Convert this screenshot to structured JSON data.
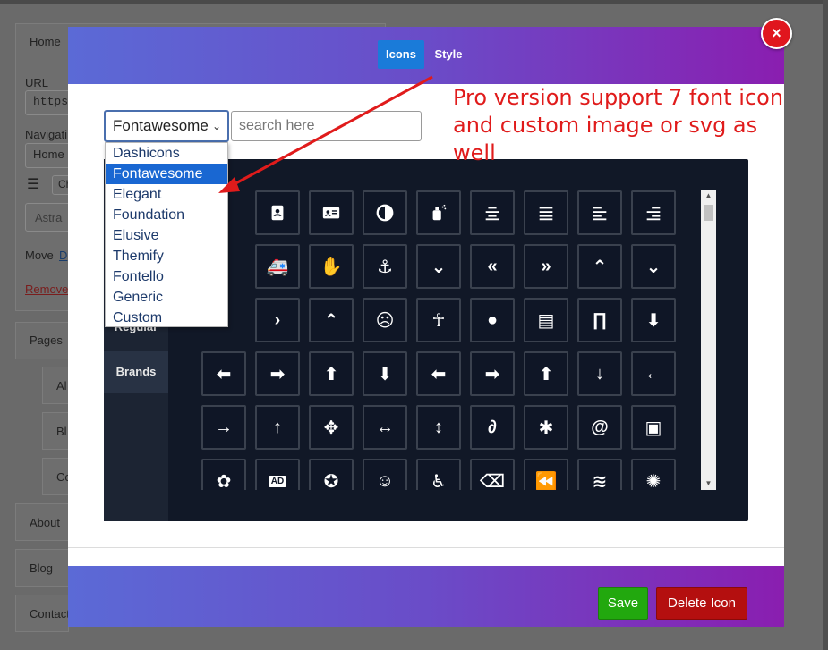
{
  "background": {
    "home_label": "Home",
    "url_label": "URL",
    "url_value": "https",
    "navigation_label": "Navigati",
    "navigation_value": "Home",
    "chip_text": "Ch",
    "astra_text": "Astra",
    "move_label": "Move",
    "move_link": "D",
    "remove_link": "Remove",
    "sections": [
      "Pages",
      "About",
      "Blog",
      "Contact"
    ],
    "subitems": [
      "Al",
      "Bl",
      "Co"
    ]
  },
  "modal": {
    "tabs": [
      {
        "label": "Icons",
        "active": true
      },
      {
        "label": "Style",
        "active": false
      }
    ],
    "close_symbol": "×",
    "select": {
      "value": "Fontawesome",
      "chevron": "⌄"
    },
    "search": {
      "placeholder": "search here"
    },
    "dropdown_options": [
      "Dashicons",
      "Fontawesome",
      "Elegant",
      "Foundation",
      "Elusive",
      "Themify",
      "Fontello",
      "Generic",
      "Custom"
    ],
    "dropdown_selected_index": 1,
    "side_tabs": [
      {
        "label": "Regular",
        "active": false
      },
      {
        "label": "Brands",
        "active": true
      }
    ],
    "icons": [
      [
        "address-book-icon",
        "address-card-icon",
        "adjust-icon",
        "air-freshener-icon",
        "align-center-icon",
        "align-justify-icon",
        "align-left-icon",
        "align-right-icon"
      ],
      [
        "ambulance-icon",
        "american-sign-language-icon",
        "anchor-icon",
        "angle-double-down-icon",
        "angle-double-left-icon",
        "angle-double-right-icon",
        "angle-double-up-icon",
        "angle-down-icon"
      ],
      [
        "angle-right-icon",
        "angle-up-icon",
        "angry-icon",
        "ankh-icon",
        "apple-alt-icon",
        "archive-icon",
        "archway-icon",
        "arrow-circle-down-icon"
      ],
      [
        "arrow-circle-left-icon",
        "arrow-circle-right-icon",
        "arrow-circle-up-icon",
        "arrow-alt-circle-down-icon",
        "arrow-alt-circle-left-icon",
        "arrow-alt-circle-right-icon",
        "arrow-alt-circle-up-icon",
        "arrow-down-icon",
        "arrow-left-icon"
      ],
      [
        "arrow-right-icon",
        "arrow-up-icon",
        "arrows-alt-icon",
        "arrows-alt-h-icon",
        "arrows-alt-v-icon",
        "assistive-listening-icon",
        "asterisk-icon",
        "at-icon",
        "atlas-icon"
      ],
      [
        "atom-icon",
        "ad-icon",
        "award-icon",
        "baby-icon",
        "baby-carriage-icon",
        "backspace-icon",
        "backward-icon",
        "bacon-icon",
        "bacteria-icon"
      ]
    ],
    "ad_badge": "AD",
    "save_label": "Save",
    "delete_label": "Delete Icon"
  },
  "annotation": {
    "line1": "Pro version support 7 font icon",
    "line2": "and custom image or svg as well",
    "color": "#e01b1b"
  },
  "colors": {
    "accent_tab": "#1a7bd9",
    "header_gradient_start": "#5b6ad6",
    "header_gradient_end": "#8a1eb0",
    "close": "#e0161e",
    "save": "#22a80e",
    "delete": "#b40f0f",
    "icon_panel": "#111827"
  }
}
